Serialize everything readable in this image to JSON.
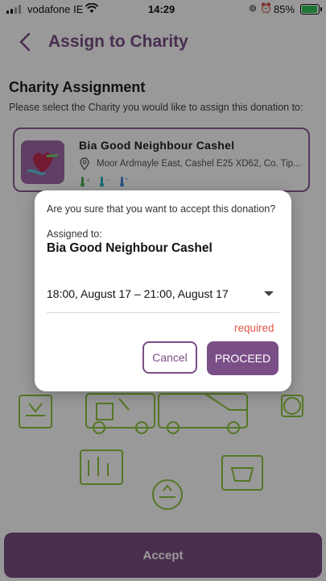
{
  "status_bar": {
    "carrier": "vodafone IE",
    "time": "14:29",
    "battery": "85%",
    "battery_level": 0.85
  },
  "header": {
    "title": "Assign to Charity"
  },
  "section": {
    "title": "Charity Assignment",
    "subtitle": "Please select the Charity you would like to assign this donation to:"
  },
  "charity": {
    "name": "Bia Good Neighbour Cashel",
    "address": "Moor Ardmayle East, Cashel E25 XD62, Co. Tip...",
    "temp_icons": [
      "thermometer-ambient-icon",
      "thermometer-chilled-icon",
      "thermometer-frozen-icon"
    ]
  },
  "dialog": {
    "question": "Are you sure that you want to accept this donation?",
    "assigned_label": "Assigned to:",
    "assigned_name": "Bia Good Neighbour Cashel",
    "time_slot": "18:00, August 17 – 21:00, August 17",
    "required": "required",
    "cancel_label": "Cancel",
    "proceed_label": "PROCEED"
  },
  "footer": {
    "accept_label": "Accept"
  },
  "colors": {
    "brand": "#7a4e86",
    "required": "#e3554a",
    "illustration": "#8cc63f"
  }
}
